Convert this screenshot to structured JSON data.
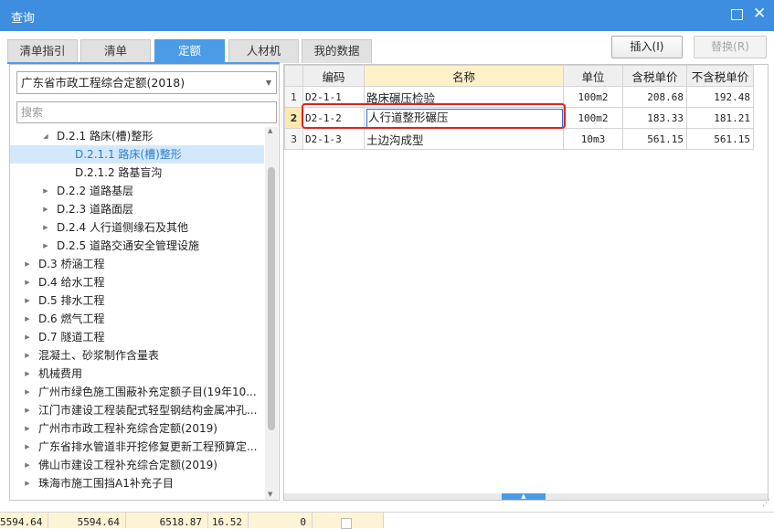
{
  "window": {
    "title": "查询",
    "maximize_icon": "maximize-icon",
    "close_icon": "close-icon",
    "close_glyph": "✕"
  },
  "tabs": [
    {
      "label": "清单指引",
      "active": false
    },
    {
      "label": "清单",
      "active": false
    },
    {
      "label": "定额",
      "active": true
    },
    {
      "label": "人材机",
      "active": false
    },
    {
      "label": "我的数据",
      "active": false
    }
  ],
  "actions": {
    "insert_label": "插入(I)",
    "replace_label": "替换(R)"
  },
  "library_select": {
    "value": "广东省市政工程综合定额(2018)"
  },
  "search": {
    "placeholder": "搜索"
  },
  "tree": [
    {
      "label": "D.2.1 路床(槽)整形",
      "toggle": "expanded",
      "level": 2
    },
    {
      "label": "D.2.1.1 路床(槽)整形",
      "toggle": "none",
      "level": 3,
      "selected": true
    },
    {
      "label": "D.2.1.2 路基盲沟",
      "toggle": "none",
      "level": 3
    },
    {
      "label": "D.2.2 道路基层",
      "toggle": "collapsed",
      "level": 2
    },
    {
      "label": "D.2.3 道路面层",
      "toggle": "collapsed",
      "level": 2
    },
    {
      "label": "D.2.4 人行道侧缘石及其他",
      "toggle": "collapsed",
      "level": 2
    },
    {
      "label": "D.2.5 道路交通安全管理设施",
      "toggle": "collapsed",
      "level": 2
    },
    {
      "label": "D.3 桥涵工程",
      "toggle": "collapsed",
      "level": 1
    },
    {
      "label": "D.4 给水工程",
      "toggle": "collapsed",
      "level": 1
    },
    {
      "label": "D.5 排水工程",
      "toggle": "collapsed",
      "level": 1
    },
    {
      "label": "D.6 燃气工程",
      "toggle": "collapsed",
      "level": 1
    },
    {
      "label": "D.7 隧道工程",
      "toggle": "collapsed",
      "level": 1
    },
    {
      "label": "混凝土、砂浆制作含量表",
      "toggle": "collapsed",
      "level": 1
    },
    {
      "label": "机械费用",
      "toggle": "collapsed",
      "level": 1
    },
    {
      "label": "广州市绿色施工围蔽补充定额子目(19年10...",
      "toggle": "collapsed",
      "level": 1
    },
    {
      "label": "江门市建设工程装配式轻型钢结构金属冲孔...",
      "toggle": "collapsed",
      "level": 1
    },
    {
      "label": "广州市市政工程补充综合定额(2019)",
      "toggle": "collapsed",
      "level": 1
    },
    {
      "label": "广东省排水管道非开挖修复更新工程预算定...",
      "toggle": "collapsed",
      "level": 1
    },
    {
      "label": "佛山市建设工程补充综合定额(2019)",
      "toggle": "collapsed",
      "level": 1
    },
    {
      "label": "珠海市施工围挡A1补充子目",
      "toggle": "collapsed",
      "level": 1
    }
  ],
  "grid": {
    "columns": [
      "编码",
      "名称",
      "单位",
      "含税单价",
      "不含税单价"
    ],
    "rows": [
      {
        "no": "1",
        "code": "D2-1-1",
        "name": "路床碾压检验",
        "unit": "100m2",
        "tax_price": "208.68",
        "notax_price": "192.48"
      },
      {
        "no": "2",
        "code": "D2-1-2",
        "name": "人行道整形碾压",
        "unit": "100m2",
        "tax_price": "183.33",
        "notax_price": "181.21"
      },
      {
        "no": "3",
        "code": "D2-1-3",
        "name": "土边沟成型",
        "unit": "10m3",
        "tax_price": "561.15",
        "notax_price": "561.15"
      }
    ],
    "current_row": 2
  },
  "bottom_values": [
    "5594.64",
    "5594.64",
    "6518.87",
    "16.52",
    "0"
  ],
  "colors": {
    "titlebar": "#3d8ee0",
    "active_tab": "#4b9be6",
    "selection": "#d3e8fb",
    "highlight_border": "#e32020"
  }
}
